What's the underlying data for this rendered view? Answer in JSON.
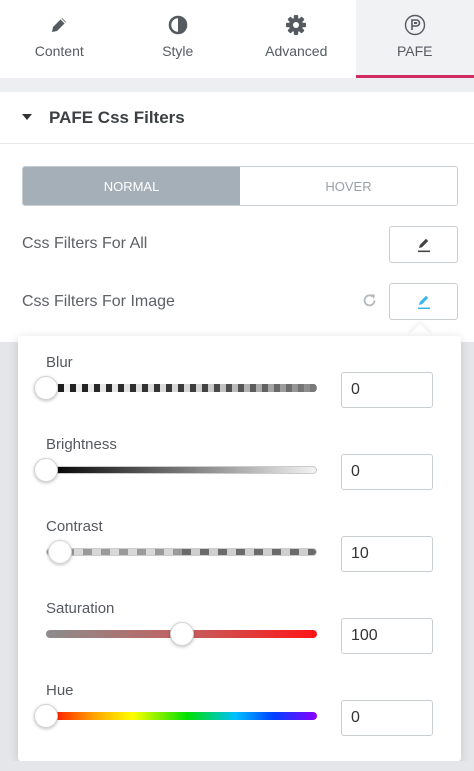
{
  "tabs": [
    {
      "label": "Content",
      "icon": "pencil-icon"
    },
    {
      "label": "Style",
      "icon": "half-circle-icon"
    },
    {
      "label": "Advanced",
      "icon": "gear-icon"
    },
    {
      "label": "PAFE",
      "icon": "pafe-logo-icon",
      "active": true
    }
  ],
  "section": {
    "title": "PAFE Css Filters"
  },
  "state_toggle": {
    "normal": "NORMAL",
    "hover": "HOVER",
    "selected": "NORMAL"
  },
  "rows": {
    "all": {
      "label": "Css Filters For All"
    },
    "image": {
      "label": "Css Filters For Image"
    }
  },
  "filters": [
    {
      "label": "Blur",
      "value": "0",
      "level": 0
    },
    {
      "label": "Brightness",
      "value": "0",
      "level": 0
    },
    {
      "label": "Contrast",
      "value": "10",
      "level": 0.05
    },
    {
      "label": "Saturation",
      "value": "100",
      "level": 0.5
    },
    {
      "label": "Hue",
      "value": "0",
      "level": 0
    }
  ],
  "colors": {
    "accent": "#cf2a62",
    "active_toggle": "#a4afb7",
    "edit_icon_active": "#3ab7e8"
  }
}
